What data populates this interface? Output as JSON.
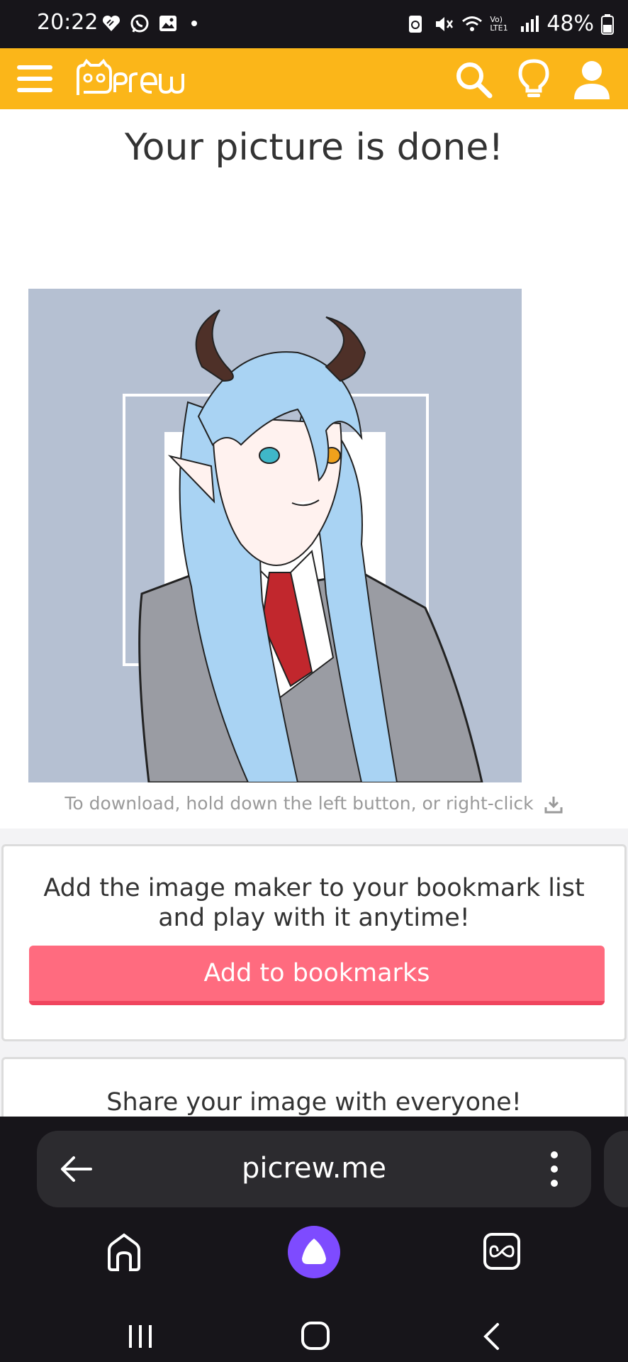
{
  "status_bar": {
    "time": "20:22",
    "battery": "48%",
    "network_label": "Vo) LTE1"
  },
  "header": {
    "logo_text": "Picrew",
    "accent_color": "#fbb619"
  },
  "main": {
    "title": "Your picture is done!",
    "download_hint": "To download, hold down the left button, or right-click"
  },
  "bookmark_card": {
    "text_line1": "Add the image maker to your bookmark list",
    "text_line2": "and play with it anytime!",
    "button_label": "Add to bookmarks",
    "button_color": "#ff6b7f"
  },
  "share_card": {
    "text": "Share your image with everyone!"
  },
  "browser": {
    "url": "picrew.me"
  },
  "icons": {
    "menu": "hamburger-menu-icon",
    "search": "search-icon",
    "idea": "lightbulb-icon",
    "account": "user-icon",
    "download": "download-icon",
    "back": "arrow-left-icon",
    "more": "vertical-dots-icon",
    "home": "home-icon",
    "assistant": "alice-icon",
    "tabs": "tabs-icon"
  }
}
